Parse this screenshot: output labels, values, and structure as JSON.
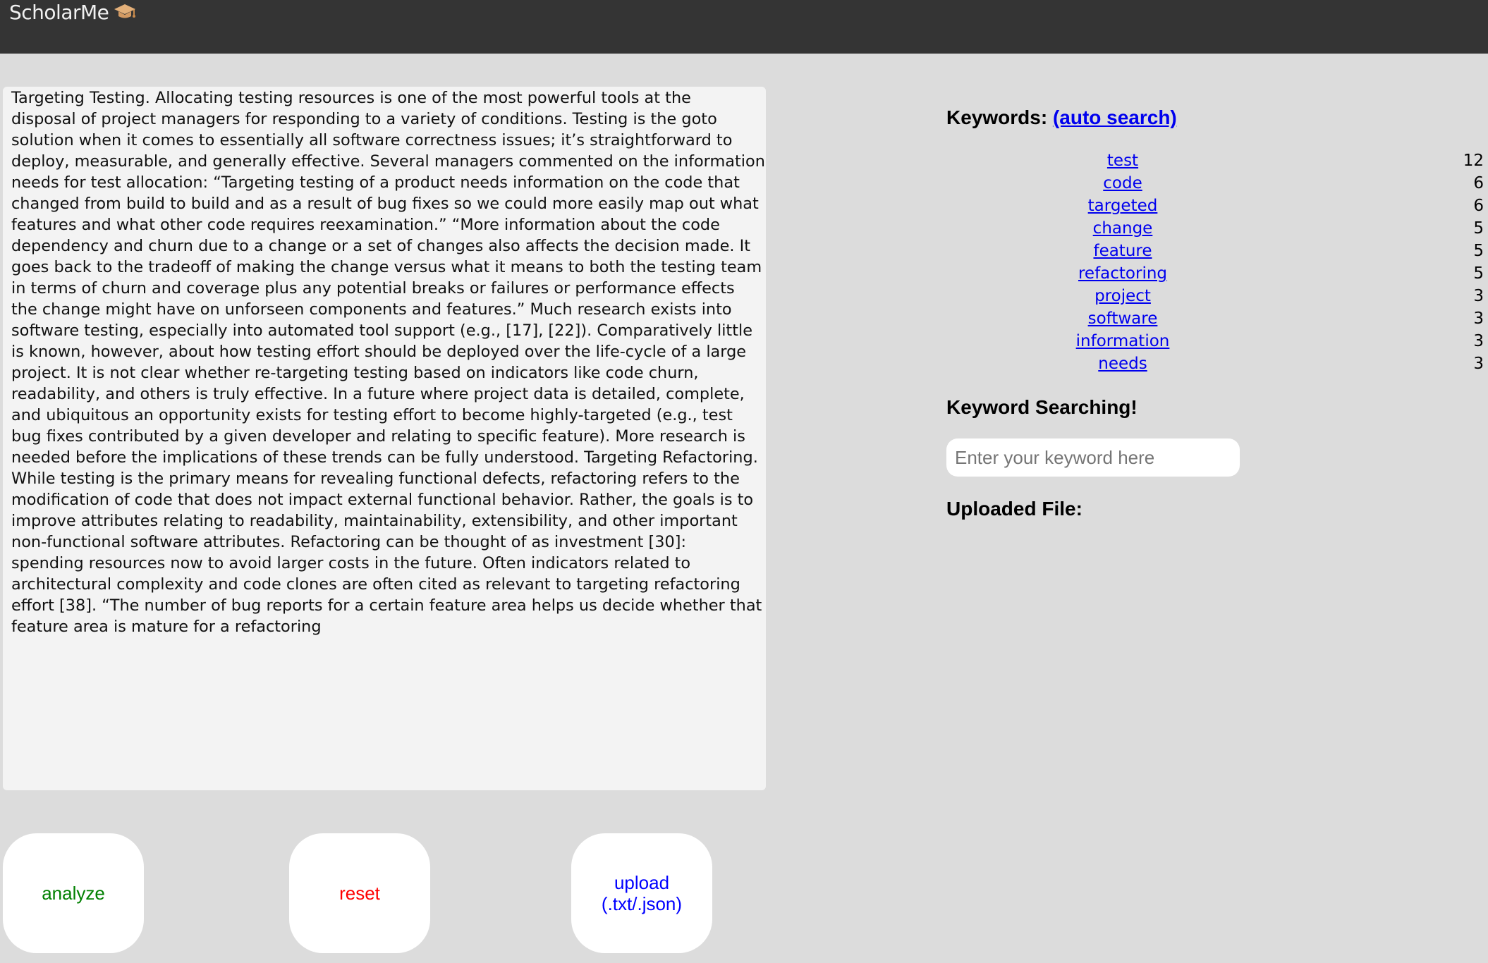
{
  "header": {
    "brand": "ScholarMe",
    "brand_icon": "graduation-cap-icon",
    "background": "#343434"
  },
  "editor": {
    "text": "Targeting Testing. Allocating testing resources is one of the most powerful tools at the\ndisposal of project managers for responding to a variety of conditions. Testing is the goto\nsolution when it comes to essentially all software correctness issues; it’s straightforward to\ndeploy, measurable, and generally effective. Several managers commented on the information\nneeds for test allocation: “Targeting testing of a product needs information on the code that\nchanged from build to build and as a result of bug fixes so we could more easily map out what\nfeatures and what other code requires reexamination.” “More information about the code\ndependency and churn due to a change or a set of changes also affects the decision made. It\ngoes back to the tradeoff of making the change versus what it means to both the testing team\nin terms of churn and coverage plus any potential breaks or failures or performance effects\nthe change might have on unforseen components and features.” Much research exists into\nsoftware testing, especially into automated tool support (e.g., [17], [22]). Comparatively little\nis known, however, about how testing effort should be deployed over the life-cycle of a large\nproject. It is not clear whether re-targeting testing based on indicators like code churn,\nreadability, and others is truly effective. In a future where project data is detailed, complete,\nand ubiquitous an opportunity exists for testing effort to become highly-targeted (e.g., test\nbug fixes contributed by a given developer and relating to specific feature). More research is\nneeded before the implications of these trends can be fully understood. Targeting Refactoring.\nWhile testing is the primary means for revealing functional defects, refactoring refers to the\nmodification of code that does not impact external functional behavior. Rather, the goals is to\nimprove attributes relating to readability, maintainability, extensibility, and other important\nnon-functional software attributes. Refactoring can be thought of as investment [30]:\nspending resources now to avoid larger costs in the future. Often indicators related to\narchitectural complexity and code clones are often cited as relevant to targeting refactoring\neffort [38]. “The number of bug reports for a certain feature area helps us decide whether that\nfeature area is mature for a refactoring"
  },
  "actions": {
    "analyze": {
      "label": "analyze",
      "color": "#008000"
    },
    "reset": {
      "label": "reset",
      "color": "#ff0000"
    },
    "upload": {
      "label": "upload\n(.txt/.json)",
      "color": "#0000ff"
    }
  },
  "keywords": {
    "title": "Keywords:",
    "auto_search": "(auto search)",
    "items": [
      {
        "word": "test",
        "count": "12"
      },
      {
        "word": "code",
        "count": "6"
      },
      {
        "word": "targeted",
        "count": "6"
      },
      {
        "word": "change",
        "count": "5"
      },
      {
        "word": "feature",
        "count": "5"
      },
      {
        "word": "refactoring",
        "count": "5"
      },
      {
        "word": "project",
        "count": "3"
      },
      {
        "word": "software",
        "count": "3"
      },
      {
        "word": "information",
        "count": "3"
      },
      {
        "word": "needs",
        "count": "3"
      }
    ]
  },
  "search": {
    "title": "Keyword Searching!",
    "placeholder": "Enter your keyword here",
    "value": ""
  },
  "upload_section": {
    "title": "Uploaded File:"
  }
}
